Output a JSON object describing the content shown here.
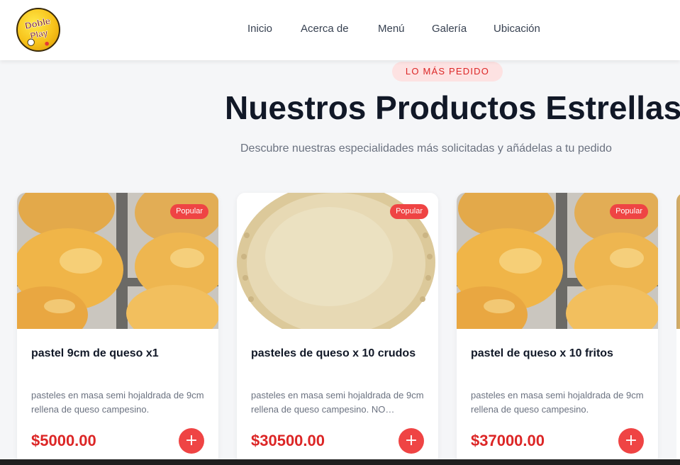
{
  "header": {
    "logo_text": "Doble Play",
    "nav": [
      "Inicio",
      "Acerca de",
      "Menú",
      "Galería",
      "Ubicación"
    ]
  },
  "section": {
    "badge": "LO MÁS PEDIDO",
    "title": "Nuestros Productos Estrellas",
    "subtitle": "Descubre nuestras especialidades más solicitadas y añádelas a tu pedido"
  },
  "products": [
    {
      "badge": "Popular",
      "name": "pastel 9cm de queso x1",
      "description": "pasteles en masa semi hojaldrada de 9cm rellena de queso campesino.",
      "price": "$5000.00",
      "add_label": "+",
      "image": "fried-pastries"
    },
    {
      "badge": "Popular",
      "name": "pasteles de queso x 10 crudos",
      "description": "pasteles en masa semi hojaldrada de 9cm rellena de queso campesino. NO…",
      "price": "$30500.00",
      "add_label": "+",
      "image": "raw-pastry"
    },
    {
      "badge": "Popular",
      "name": "pastel de queso x 10 fritos",
      "description": "pasteles en masa semi hojaldrada de 9cm rellena de queso campesino.",
      "price": "$37000.00",
      "add_label": "+",
      "image": "fried-pastries"
    }
  ],
  "colors": {
    "accent": "#ef4444",
    "price": "#dc2626",
    "badge_bg": "#fde2e2",
    "page_bg": "#f5f6f8"
  }
}
